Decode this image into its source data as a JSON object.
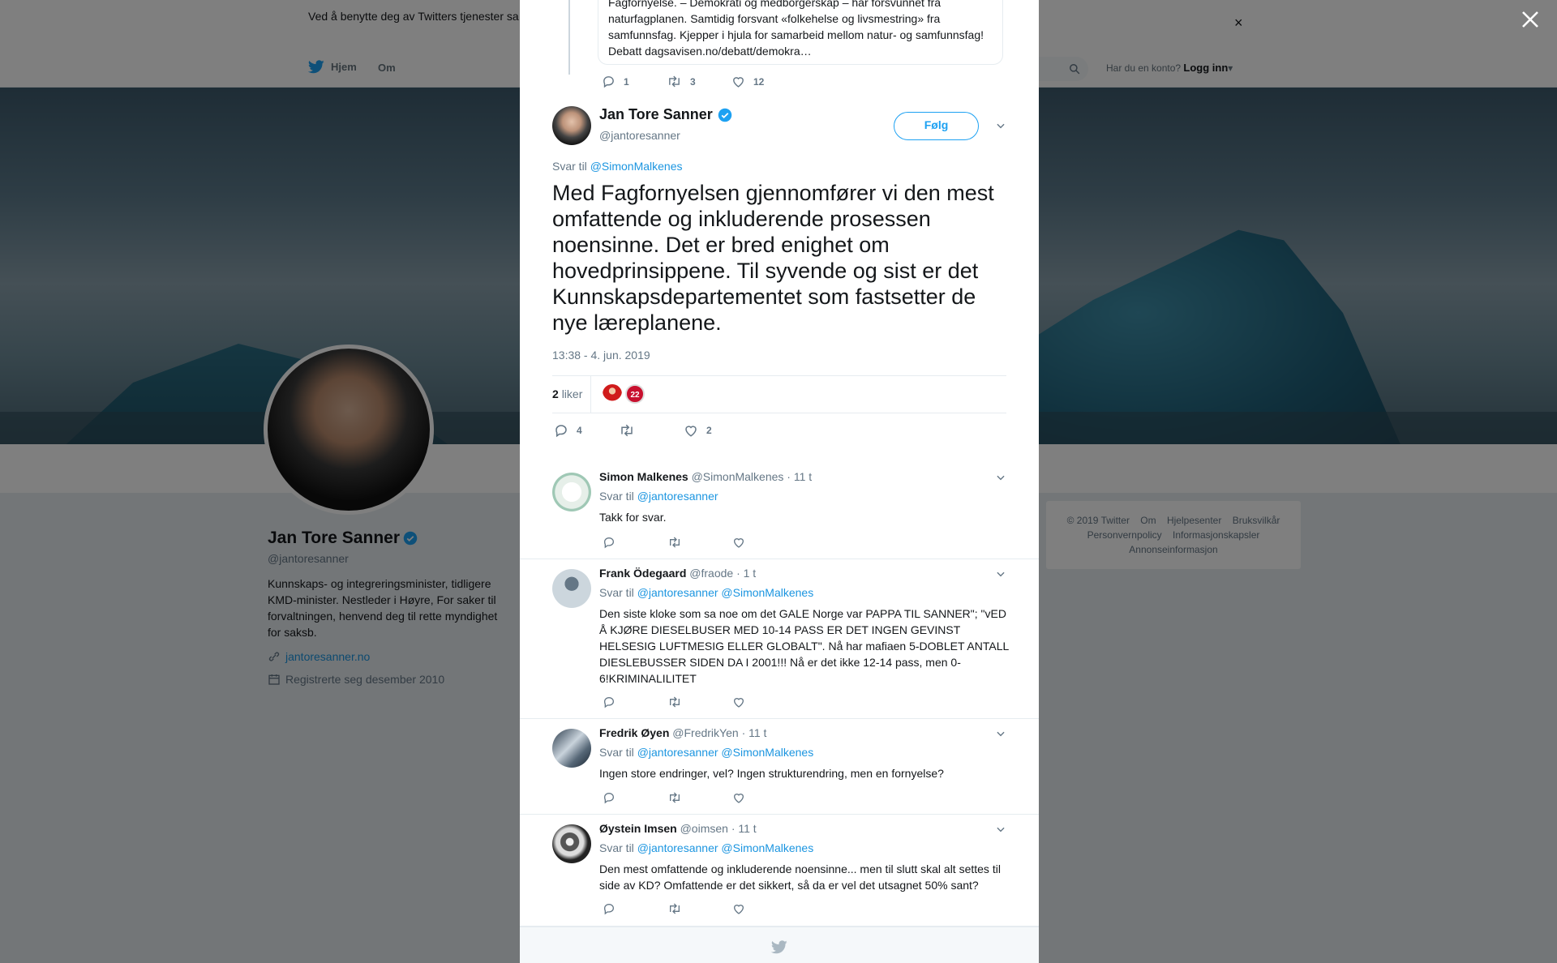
{
  "cookie_bar": {
    "text": "Ved å benytte deg av Twitters tjenester sa                                                                                                                                                                 informasjonskapsler til bl.a. analyser, personalisering og annonser."
  },
  "nav": {
    "home": "Hjem",
    "about": "Om",
    "login_prompt": "Har du en konto?",
    "login": "Logg inn"
  },
  "profile": {
    "name": "Jan Tore Sanner",
    "handle": "@jantoresanner",
    "bio": "Kunnskaps- og integreringsminister, tidligere KMD-minister. Nestleder i Høyre, For saker til forvaltningen, henvend deg til rette myndighet for saksb.",
    "link": "jantoresanner.no",
    "joined": "Registrerte seg desember 2010"
  },
  "footer": {
    "row1": [
      "© 2019 Twitter",
      "Om",
      "Hjelpesenter",
      "Bruksvilkår"
    ],
    "row2": [
      "Personvernpolicy",
      "Informasjonskapsler"
    ],
    "row3": [
      "Annonseinformasjon"
    ]
  },
  "previous_tweet": {
    "quote_lines": [
      "Fagfornyelse. – Demokrati og medborgerskap – har forsvunnet fra",
      "naturfagplanen. Samtidig forsvant «folkehelse og livsmestring» fra",
      "samfunnsfag. Kjepper i hjula for samarbeid mellom natur- og samfunnsfag!",
      "Debatt dagsavisen.no/debatt/demokra…"
    ],
    "replies": "1",
    "retweets": "3",
    "likes": "12"
  },
  "tweet": {
    "author": "Jan Tore Sanner",
    "handle": "@jantoresanner",
    "follow": "Følg",
    "reply_prefix": "Svar til",
    "reply_to": "@SimonMalkenes",
    "text": "Med Fagfornyelsen gjennomfører vi den mest omfattende og inkluderende prosessen noensinne. Det er bred enighet om hovedprinsippene. Til syvende og sist er det Kunnskapsdepartementet som fastsetter de nye læreplanene.",
    "timestamp": "13:38 - 4. jun. 2019",
    "likes_count": "2",
    "likes_label": "liker",
    "liker2_badge": "22",
    "replies": "4",
    "retweets": "",
    "likes": "2"
  },
  "replies": [
    {
      "name": "Simon Malkenes",
      "handle": "@SimonMalkenes",
      "time": "· 11 t",
      "reply_prefix": "Svar til",
      "mentions": "@jantoresanner",
      "text": "Takk for svar."
    },
    {
      "name": "Frank Ödegaard",
      "handle": "@fraode",
      "time": "· 1 t",
      "reply_prefix": "Svar til",
      "mentions": "@jantoresanner @SimonMalkenes",
      "text": "Den siste kloke som sa noe om det GALE Norge var PAPPA TIL SANNER\"; \"vED Å KJØRE DIESELBUSER MED 10-14 PASS ER DET INGEN GEVINST HELSESIG LUFTMESIG ELLER GLOBALT\".   Nå har mafiaen 5-DOBLET ANTALL DIESLEBUSSER SIDEN DA I 2001!!!  Nå er det ikke 12-14 pass, men 0-6!KRIMINALILITET"
    },
    {
      "name": "Fredrik Øyen",
      "handle": "@FredrikYen",
      "time": "· 11 t",
      "reply_prefix": "Svar til",
      "mentions": "@jantoresanner @SimonMalkenes",
      "text": "Ingen store endringer, vel? Ingen strukturendring, men en fornyelse?"
    },
    {
      "name": "Øystein Imsen",
      "handle": "@oimsen",
      "time": "· 11 t",
      "reply_prefix": "Svar til",
      "mentions": "@jantoresanner @SimonMalkenes",
      "text": "Den mest omfattende og inkluderende noensinne... men til slutt skal alt settes til side av KD? Omfattende er det sikkert, så da er vel det utsagnet 50% sant?"
    }
  ],
  "colors": {
    "accent": "#1da1f2",
    "link": "#1b95e0",
    "muted": "#657786"
  }
}
